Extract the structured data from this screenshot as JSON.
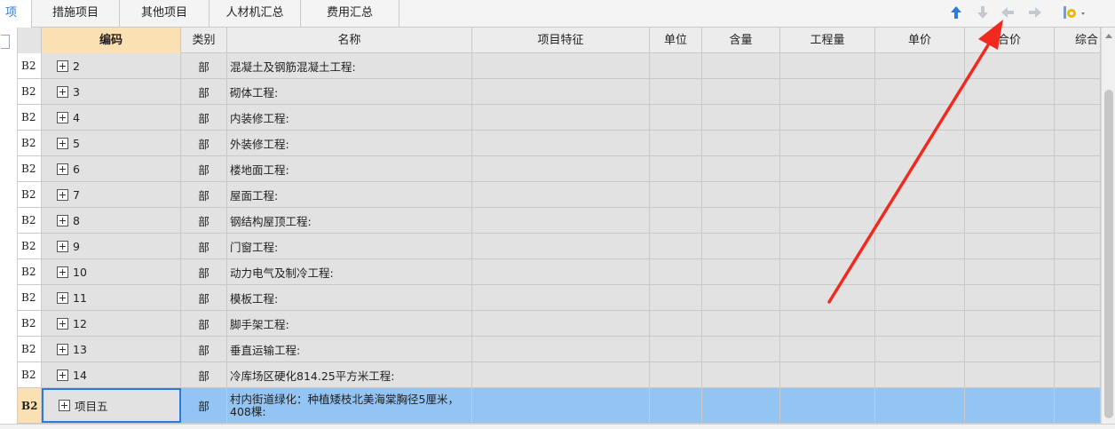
{
  "tabs": [
    {
      "label": "项"
    },
    {
      "label": "措施项目"
    },
    {
      "label": "其他项目"
    },
    {
      "label": "人材机汇总"
    },
    {
      "label": "费用汇总"
    }
  ],
  "toolbar": {
    "icons": [
      "arrow-up-icon",
      "arrow-down-icon",
      "arrow-left-icon",
      "arrow-right-icon",
      "settings-dropdown-icon"
    ],
    "accent": "#2f7ad9"
  },
  "columns": [
    "编码",
    "类别",
    "名称",
    "项目特征",
    "单位",
    "含量",
    "工程量",
    "单价",
    "合价",
    "综合"
  ],
  "rows": [
    {
      "level": "B2",
      "code": "2",
      "type": "部",
      "name": "混凝土及钢筋混凝土工程:"
    },
    {
      "level": "B2",
      "code": "3",
      "type": "部",
      "name": "砌体工程:"
    },
    {
      "level": "B2",
      "code": "4",
      "type": "部",
      "name": "内装修工程:"
    },
    {
      "level": "B2",
      "code": "5",
      "type": "部",
      "name": "外装修工程:"
    },
    {
      "level": "B2",
      "code": "6",
      "type": "部",
      "name": "楼地面工程:"
    },
    {
      "level": "B2",
      "code": "7",
      "type": "部",
      "name": "屋面工程:"
    },
    {
      "level": "B2",
      "code": "8",
      "type": "部",
      "name": "钢结构屋顶工程:"
    },
    {
      "level": "B2",
      "code": "9",
      "type": "部",
      "name": "门窗工程:"
    },
    {
      "level": "B2",
      "code": "10",
      "type": "部",
      "name": "动力电气及制冷工程:"
    },
    {
      "level": "B2",
      "code": "11",
      "type": "部",
      "name": "模板工程:"
    },
    {
      "level": "B2",
      "code": "12",
      "type": "部",
      "name": "脚手架工程:"
    },
    {
      "level": "B2",
      "code": "13",
      "type": "部",
      "name": "垂直运输工程:"
    },
    {
      "level": "B2",
      "code": "14",
      "type": "部",
      "name": "冷库场区硬化814.25平方米工程:"
    },
    {
      "level": "B2",
      "code": "项目五",
      "type": "部",
      "name": "村内街道绿化：种植矮枝北美海棠胸径5厘米，408棵:"
    }
  ],
  "colors": {
    "grid_row": "#e2e2e2",
    "selected_row": "#94c4f2",
    "header_selected": "#fbe0b4",
    "annotation_arrow": "#f02a1f"
  }
}
